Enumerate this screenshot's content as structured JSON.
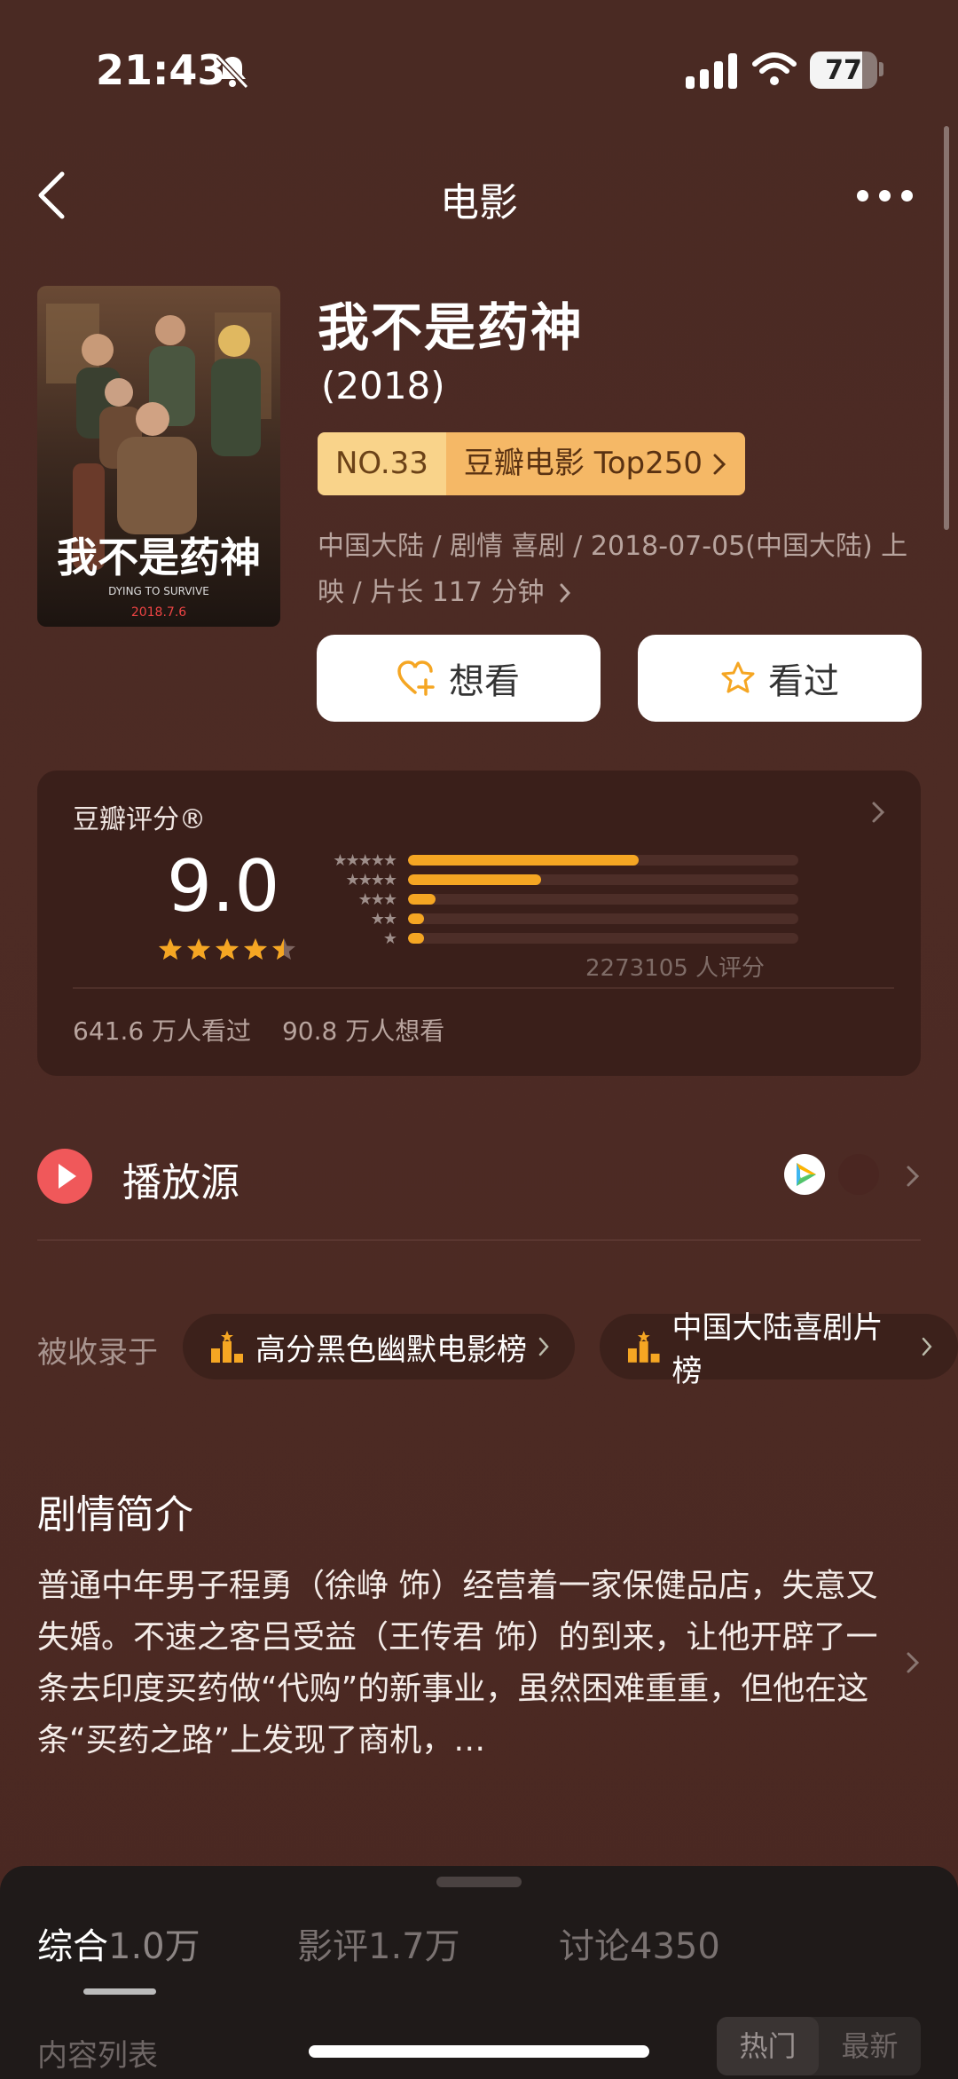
{
  "status_bar": {
    "time": "21:43",
    "battery": "77"
  },
  "nav": {
    "title": "电影"
  },
  "movie": {
    "title": "我不是药神",
    "year": "(2018)",
    "rank_no": "NO.33",
    "rank_list": "豆瓣电影 Top250",
    "meta": "中国大陆 / 剧情 喜剧 / 2018-07-05(中国大陆) 上映 / 片长 117 分钟",
    "poster_title": "我不是药神",
    "poster_subtitle": "DYING TO SURVIVE",
    "poster_date": "2018.7.6"
  },
  "actions": {
    "want_label": "想看",
    "watched_label": "看过"
  },
  "rating": {
    "label": "豆瓣评分®",
    "score": "9.0",
    "stars_value": 4.5,
    "distribution": [
      0.59,
      0.34,
      0.07,
      0.04,
      0.04
    ],
    "votes": "2273105 人评分",
    "watched": "641.6 万人看过",
    "wants": "90.8 万人想看"
  },
  "play": {
    "label": "播放源"
  },
  "collected": {
    "label": "被收录于",
    "chips": [
      "高分黑色幽默电影榜",
      "中国大陆喜剧片榜"
    ]
  },
  "synopsis": {
    "heading": "剧情简介",
    "text": "普通中年男子程勇（徐峥 饰）经营着一家保健品店，失意又失婚。不速之客吕受益（王传君 饰）的到来，让他开辟了一条去印度买药做“代购”的新事业，虽然困难重重，但他在这条“买药之路”上发现了商机，…"
  },
  "tabs": [
    {
      "label": "综合",
      "count": "1.0万"
    },
    {
      "label": "影评",
      "count": "1.7万"
    },
    {
      "label": "讨论",
      "count": "4350"
    }
  ],
  "content_list": {
    "label": "内容列表",
    "sort_hot": "热门",
    "sort_new": "最新"
  }
}
